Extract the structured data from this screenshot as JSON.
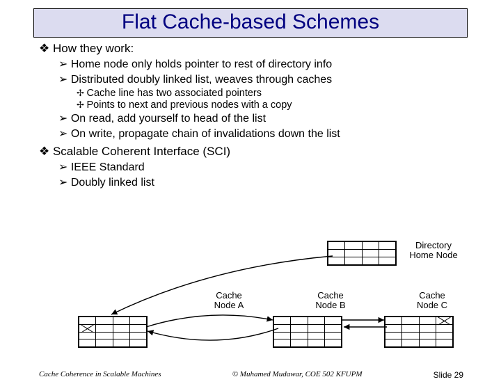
{
  "title": "Flat Cache-based Schemes",
  "sections": [
    {
      "text": "How they work:",
      "children": [
        {
          "text": "Home node only holds pointer to rest of directory info"
        },
        {
          "text": "Distributed doubly linked list, weaves through caches",
          "children": [
            {
              "text": "Cache line has two associated pointers"
            },
            {
              "text": "Points to next and previous nodes with a copy"
            }
          ]
        },
        {
          "text": "On read, add yourself to head of the list"
        },
        {
          "text": "On write, propagate chain of invalidations down the list"
        }
      ]
    },
    {
      "text": "Scalable Coherent Interface (SCI)",
      "children": [
        {
          "text": "IEEE Standard"
        },
        {
          "text": "Doubly linked list"
        }
      ]
    }
  ],
  "diagram": {
    "home_label": "Directory\nHome Node",
    "nodeA": "Cache\nNode A",
    "nodeB": "Cache\nNode B",
    "nodeC": "Cache\nNode C"
  },
  "footer": {
    "left": "Cache Coherence in Scalable Machines",
    "center": "© Muhamed Mudawar, COE 502 KFUPM",
    "right": "Slide 29"
  }
}
